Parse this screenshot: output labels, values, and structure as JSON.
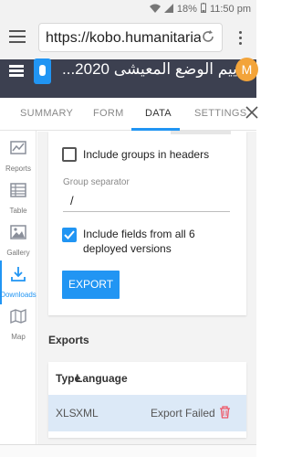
{
  "status_bar": {
    "battery": "18%",
    "time": "11:50 pm"
  },
  "browser": {
    "url": "https://kobo.humanitarian"
  },
  "app": {
    "title": "...ييم الوضع المعيشى 2020",
    "avatar_letter": "M",
    "brand_color": "#3c4050",
    "accent_color": "#2195f3"
  },
  "tabs": [
    {
      "label": "SUMMARY"
    },
    {
      "label": "FORM"
    },
    {
      "label": "DATA",
      "active": true
    },
    {
      "label": "SETTINGS"
    }
  ],
  "sidebar": {
    "items": [
      {
        "label": "Reports",
        "icon": "reports-icon"
      },
      {
        "label": "Table",
        "icon": "table-icon"
      },
      {
        "label": "Gallery",
        "icon": "gallery-icon"
      },
      {
        "label": "Downloads",
        "icon": "download-icon",
        "active": true
      },
      {
        "label": "Map",
        "icon": "map-icon"
      }
    ]
  },
  "export_options": {
    "include_groups_label": "Include groups in headers",
    "include_groups_checked": false,
    "separator_label": "Group separator",
    "separator_value": "/",
    "include_all_versions_label": "Include fields from all 6 deployed versions",
    "include_all_versions_checked": true,
    "export_button": "EXPORT"
  },
  "exports": {
    "title": "Exports",
    "headers": [
      "Type",
      "Language"
    ],
    "rows": [
      {
        "type": "XLS",
        "language": "XML",
        "status": "Export Failed"
      }
    ]
  }
}
